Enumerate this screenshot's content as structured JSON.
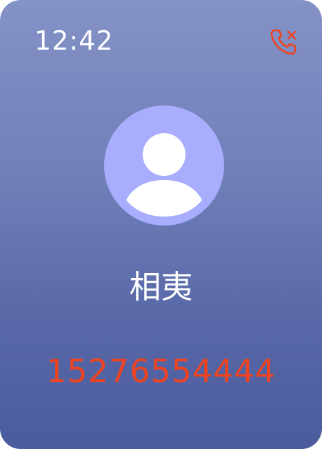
{
  "status_bar": {
    "time": "12:42",
    "missed_call_icon": "phone-missed-icon",
    "missed_call_icon_color": "#f0431f"
  },
  "contact": {
    "avatar_icon": "person-icon",
    "avatar_bg_color": "#a8aefd",
    "name": "相夷",
    "phone_number": "15276554444",
    "phone_number_color": "#f0431f"
  },
  "theme": {
    "background_top": "#8492c6",
    "background_bottom": "#4b5c9c"
  }
}
